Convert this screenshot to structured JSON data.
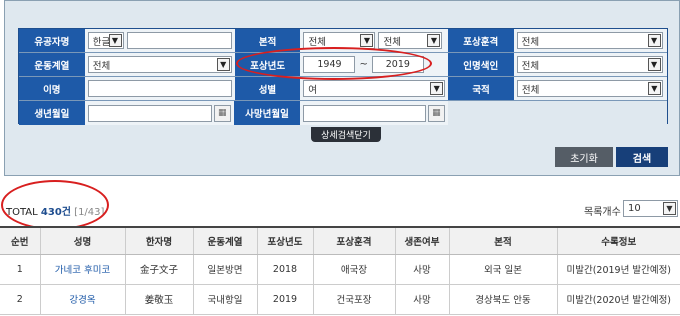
{
  "form": {
    "labels": {
      "name_type": "유공자명",
      "origin": "본적",
      "award": "포상훈격",
      "movement": "운동계열",
      "award_year": "포상년도",
      "index": "인명색인",
      "alias": "이명",
      "gender": "성별",
      "nationality": "국적",
      "birth_date": "생년월일",
      "death_date": "사망년월일"
    },
    "name_lang": "한글",
    "name_value": "",
    "origin_province": "전체",
    "origin_city": "전체",
    "award_value": "전체",
    "movement_value": "전체",
    "year_from": "1949",
    "year_sep": "~",
    "year_to": "2019",
    "index_value": "전체",
    "alias_value": "",
    "gender_value": "여",
    "nationality_value": "전체",
    "birth_value": "",
    "death_value": ""
  },
  "buttons": {
    "toggle": "상세검색닫기",
    "reset": "초기화",
    "search": "검색"
  },
  "total": {
    "prefix": "TOTAL ",
    "count": "430건",
    "pages": " [1/43]"
  },
  "page_size": {
    "label": "목록개수",
    "value": "10"
  },
  "table": {
    "headers": [
      "순번",
      "성명",
      "한자명",
      "운동계열",
      "포상년도",
      "포상훈격",
      "생존여부",
      "본적",
      "수록정보"
    ],
    "rows": [
      [
        "1",
        "가네코 후미코",
        "金子文子",
        "일본방면",
        "2018",
        "애국장",
        "사망",
        "외국 일본",
        "미발간(2019년 발간예정)"
      ],
      [
        "2",
        "강경옥",
        "姜敬玉",
        "국내항일",
        "2019",
        "건국포장",
        "사망",
        "경상북도 안동",
        "미발간(2020년 발간예정)"
      ]
    ]
  },
  "colors": {
    "label_bg": "#1e5aa8",
    "annotation": "#d81f1f",
    "search_btn": "#173f79"
  }
}
